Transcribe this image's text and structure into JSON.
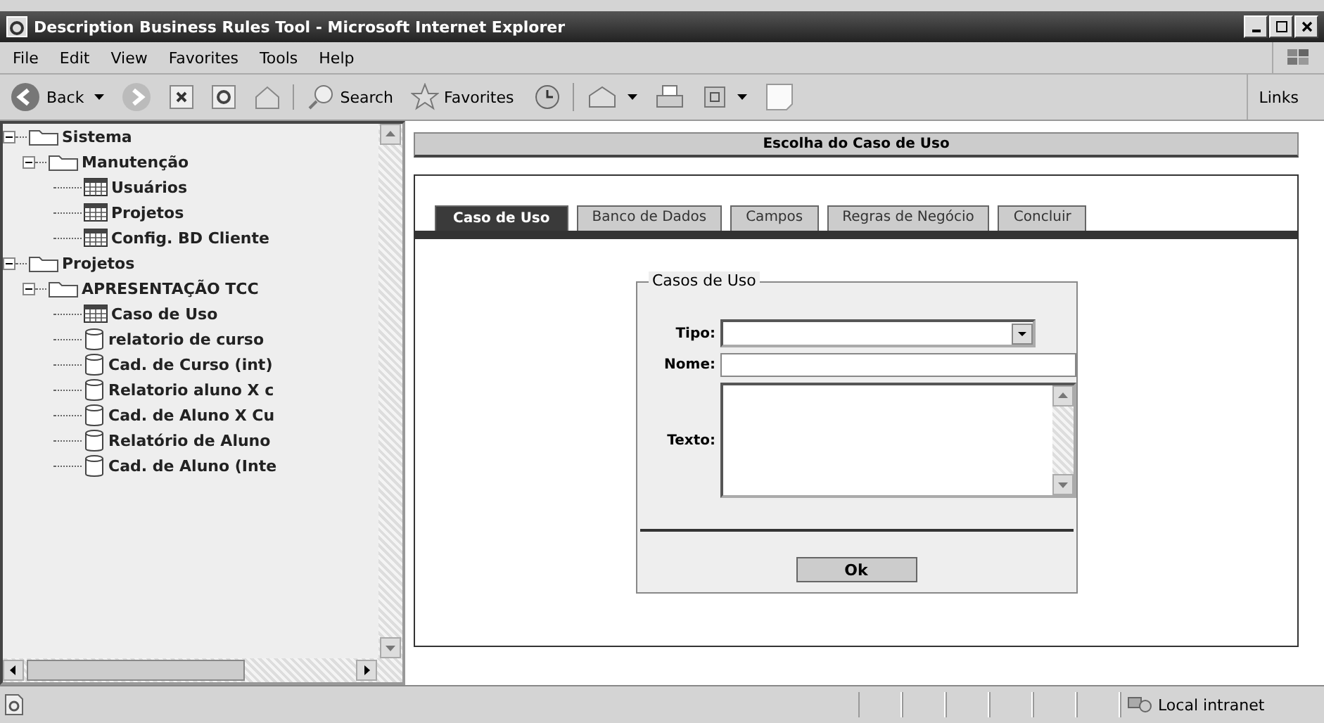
{
  "window": {
    "title": "Description Business Rules Tool - Microsoft Internet Explorer"
  },
  "menu": [
    "File",
    "Edit",
    "View",
    "Favorites",
    "Tools",
    "Help"
  ],
  "toolbar": [
    {
      "kind": "back",
      "label": "Back"
    },
    {
      "kind": "forward"
    },
    {
      "kind": "stop"
    },
    {
      "kind": "refresh"
    },
    {
      "kind": "home"
    },
    {
      "kind": "search",
      "label": "Search"
    },
    {
      "kind": "favorites",
      "label": "Favorites"
    },
    {
      "kind": "history"
    },
    {
      "kind": "mail"
    },
    {
      "kind": "print"
    },
    {
      "kind": "edit"
    },
    {
      "kind": "blank"
    }
  ],
  "links": "Links",
  "tree": [
    {
      "kind": "folder",
      "label": "Sistema",
      "expanded": true,
      "children": [
        {
          "kind": "folder",
          "label": "Manutenção",
          "expanded": true,
          "children": [
            {
              "kind": "table",
              "label": "Usuários"
            },
            {
              "kind": "table",
              "label": "Projetos"
            },
            {
              "kind": "table",
              "label": "Config. BD Cliente"
            }
          ]
        }
      ]
    },
    {
      "kind": "folder",
      "label": "Projetos",
      "expanded": true,
      "children": [
        {
          "kind": "folder",
          "label": "APRESENTAÇÃO TCC",
          "expanded": true,
          "children": [
            {
              "kind": "table",
              "label": "Caso de Uso"
            },
            {
              "kind": "database",
              "label": "relatorio de curso"
            },
            {
              "kind": "database",
              "label": "Cad. de Curso (int)"
            },
            {
              "kind": "database",
              "label": "Relatorio aluno X c"
            },
            {
              "kind": "database",
              "label": "Cad. de Aluno X Cu"
            },
            {
              "kind": "database",
              "label": "Relatório de Aluno"
            },
            {
              "kind": "database",
              "label": "Cad. de Aluno (Inte"
            }
          ]
        }
      ]
    }
  ],
  "page": {
    "heading": "Escolha do Caso de Uso",
    "tabs": [
      {
        "label": "Caso de Uso",
        "selected": true
      },
      {
        "label": "Banco de Dados",
        "selected": false
      },
      {
        "label": "Campos",
        "selected": false
      },
      {
        "label": "Regras de Negócio",
        "selected": false
      },
      {
        "label": "Concluir",
        "selected": false
      }
    ],
    "form": {
      "legend": "Casos de Uso",
      "tipo_label": "Tipo:",
      "nome_label": "Nome:",
      "texto_label": "Texto:",
      "ok": "Ok"
    }
  },
  "status_bar": {
    "zone": "Local intranet"
  }
}
